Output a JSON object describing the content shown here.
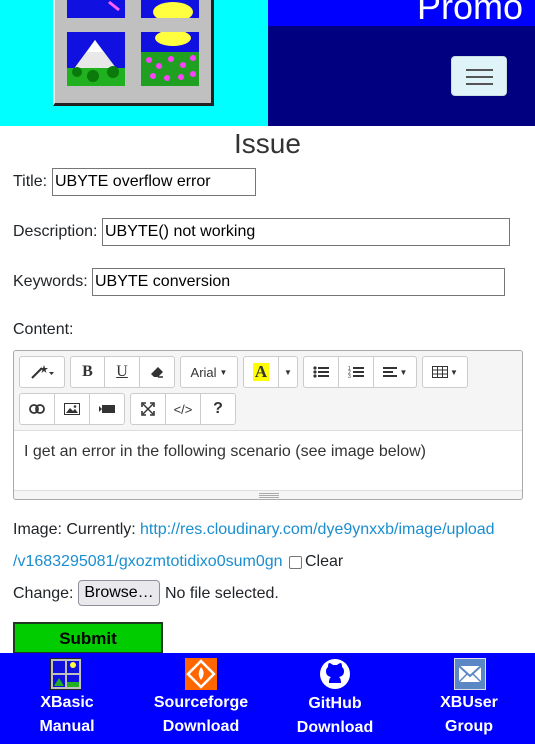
{
  "header": {
    "promo": "Promo",
    "logo_icon": "windows-logo-icon",
    "menu_icon": "hamburger-icon",
    "colors": {
      "logo_bg": "#00ffff",
      "nav_bg": "#000080",
      "promo_band": "#0000ff"
    }
  },
  "page": {
    "title": "Issue"
  },
  "form": {
    "title_label": "Title:",
    "title_value": "UBYTE overflow error",
    "description_label": "Description:",
    "description_value": "UBYTE() not working",
    "keywords_label": "Keywords:",
    "keywords_value": "UBYTE conversion",
    "content_label": "Content:",
    "content_text": "I get an error in the following scenario (see image below)",
    "image_label": "Image: Currently:",
    "image_url_line1": "http://res.cloudinary.com/dye9ynxxb/image/upload",
    "image_url_line2": "/v1683295081/gxozmtotidixo0sum0gn",
    "clear_label": "Clear",
    "change_label": "Change:",
    "browse_label": "Browse…",
    "file_status": "No file selected.",
    "submit_label": "Submit"
  },
  "toolbar": {
    "style_icon": "magic-wand-icon",
    "bold_label": "B",
    "underline_label": "U",
    "eraser_icon": "eraser-icon",
    "font_name": "Arial",
    "color_label": "A",
    "ul_icon": "unordered-list-icon",
    "ol_icon": "ordered-list-icon",
    "align_icon": "align-left-icon",
    "table_icon": "table-icon",
    "link_icon": "link-icon",
    "picture_icon": "picture-icon",
    "video_icon": "video-icon",
    "fullscreen_icon": "fullscreen-icon",
    "codeview_label": "</>",
    "help_label": "?"
  },
  "footer": {
    "items": [
      {
        "line1": "XBasic",
        "line2": "Manual",
        "icon": "xbasic-icon"
      },
      {
        "line1": "Sourceforge",
        "line2": "Download",
        "icon": "sourceforge-icon"
      },
      {
        "line1": "GitHub",
        "line2": "Download",
        "icon": "github-icon"
      },
      {
        "line1": "XBUser",
        "line2": "Group",
        "icon": "mail-icon"
      }
    ],
    "bg": "#0000ff"
  }
}
